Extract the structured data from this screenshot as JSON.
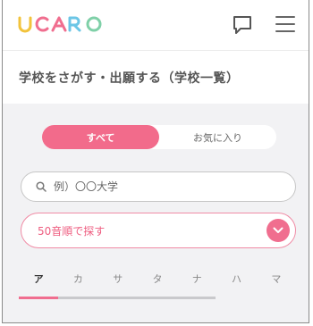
{
  "brand": {
    "logo_text": "UCARO",
    "colors": {
      "accent": "#f26b8b"
    }
  },
  "header": {
    "chat_icon": "chat-bubble-icon",
    "menu_icon": "hamburger-menu-icon"
  },
  "page_title": "学校をさがす・出願する（学校一覧）",
  "filter": {
    "tabs": [
      "すべて",
      "お気に入り"
    ],
    "selected": "すべて"
  },
  "search": {
    "placeholder": "例）〇〇大学",
    "value": ""
  },
  "kana_search": {
    "label": "50音順で探す"
  },
  "kana_tabs": {
    "items": [
      "ア",
      "カ",
      "サ",
      "タ",
      "ナ",
      "ハ",
      "マ"
    ],
    "selected": "ア"
  }
}
